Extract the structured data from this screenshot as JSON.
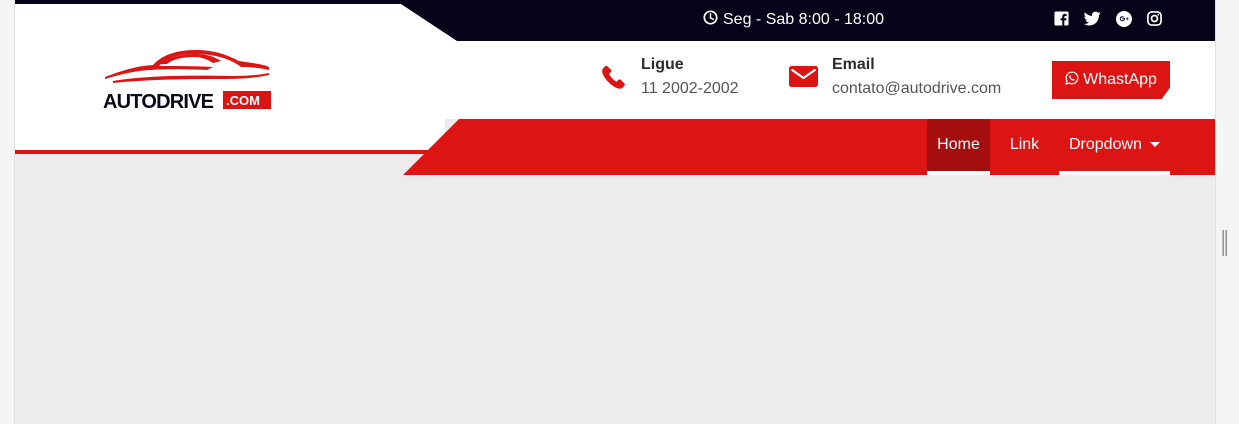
{
  "topbar": {
    "hours": "Seg - Sab 8:00 - 18:00",
    "social_icons": [
      "facebook-icon",
      "twitter-icon",
      "google-plus-icon",
      "instagram-icon"
    ]
  },
  "logo": {
    "text_main": "AUTODRIVE",
    "text_badge": ".COM"
  },
  "contacts": [
    {
      "icon": "phone-icon",
      "title": "Ligue",
      "value": "11 2002-2002"
    },
    {
      "icon": "envelope-icon",
      "title": "Email",
      "value": "contato@autodrive.com"
    }
  ],
  "whatsapp": {
    "label": "WhastApp",
    "icon": "whatsapp-icon"
  },
  "nav": {
    "items": [
      {
        "label": "Home",
        "active": true
      },
      {
        "label": "Link",
        "active": false
      },
      {
        "label": "Dropdown",
        "active": false
      }
    ]
  },
  "colors": {
    "brand_red": "#dd1414",
    "active_red": "#a50e0e",
    "topbar_navy": "#050419",
    "content_gray": "#edebec"
  }
}
